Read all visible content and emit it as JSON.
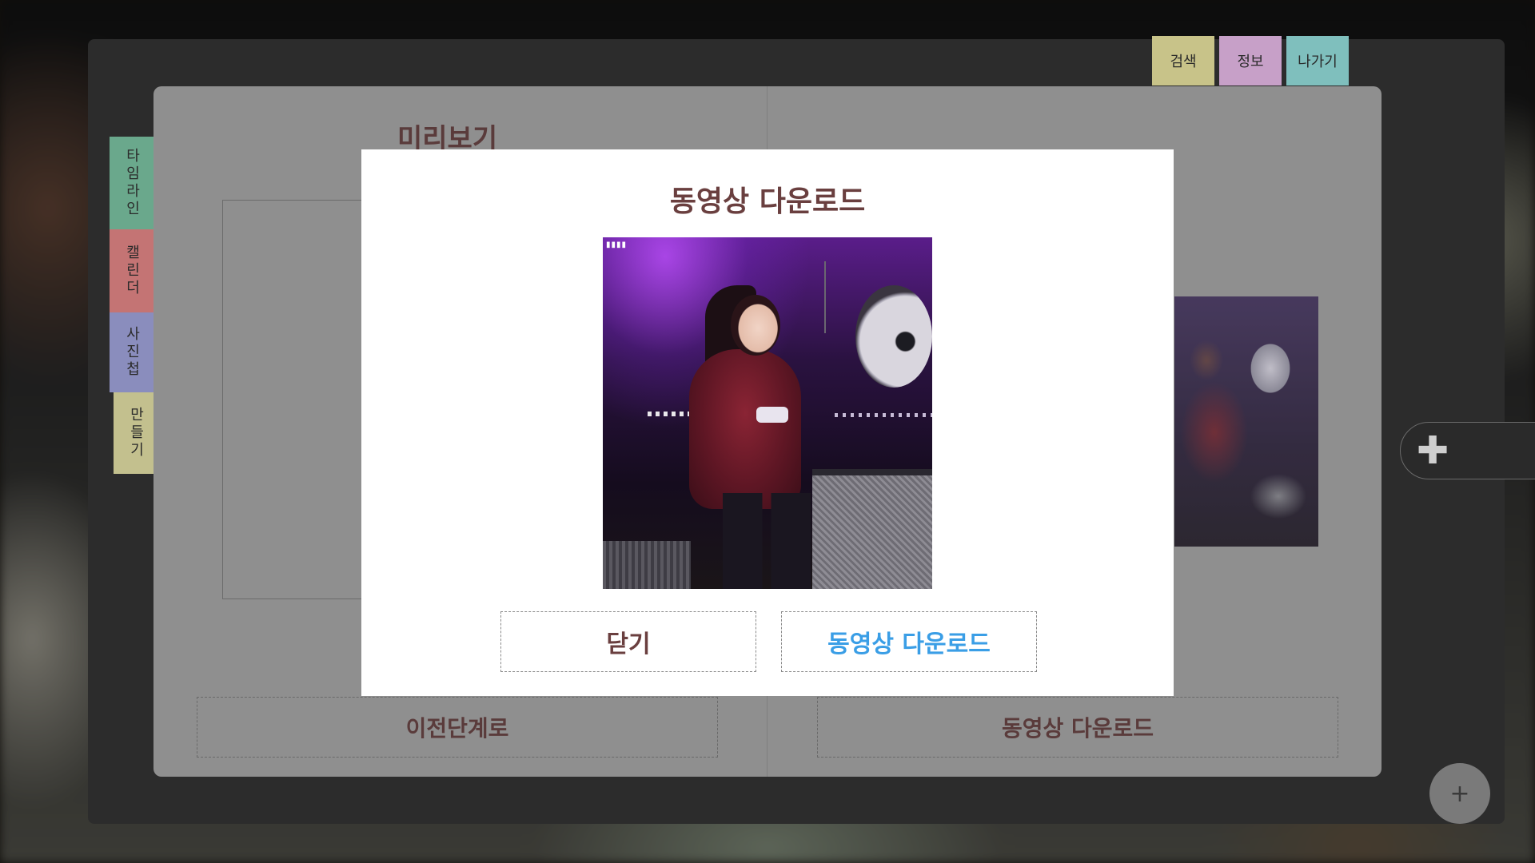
{
  "top_tabs": [
    {
      "label": "검색",
      "color": "#c8c389"
    },
    {
      "label": "정보",
      "color": "#c7a0c8"
    },
    {
      "label": "나가기",
      "color": "#7fbfbd"
    }
  ],
  "side_tabs": [
    {
      "label": "타임라인",
      "color": "#6aa88c"
    },
    {
      "label": "캘린더",
      "color": "#c47474"
    },
    {
      "label": "사진첩",
      "color": "#8a8dbd"
    },
    {
      "label": "만들기",
      "color": "#c3c08e"
    }
  ],
  "book": {
    "preview_title": "미리보기",
    "prev_button": "이전단계로",
    "download_button": "동영상 다운로드"
  },
  "modal": {
    "title": "동영상 다운로드",
    "close_button": "닫기",
    "download_button": "동영상 다운로드",
    "download_color": "#3a9ee6",
    "close_color": "#6a3f3f"
  },
  "controls": {
    "plus_icon": "plus-icon",
    "fab_icon": "plus-icon"
  }
}
